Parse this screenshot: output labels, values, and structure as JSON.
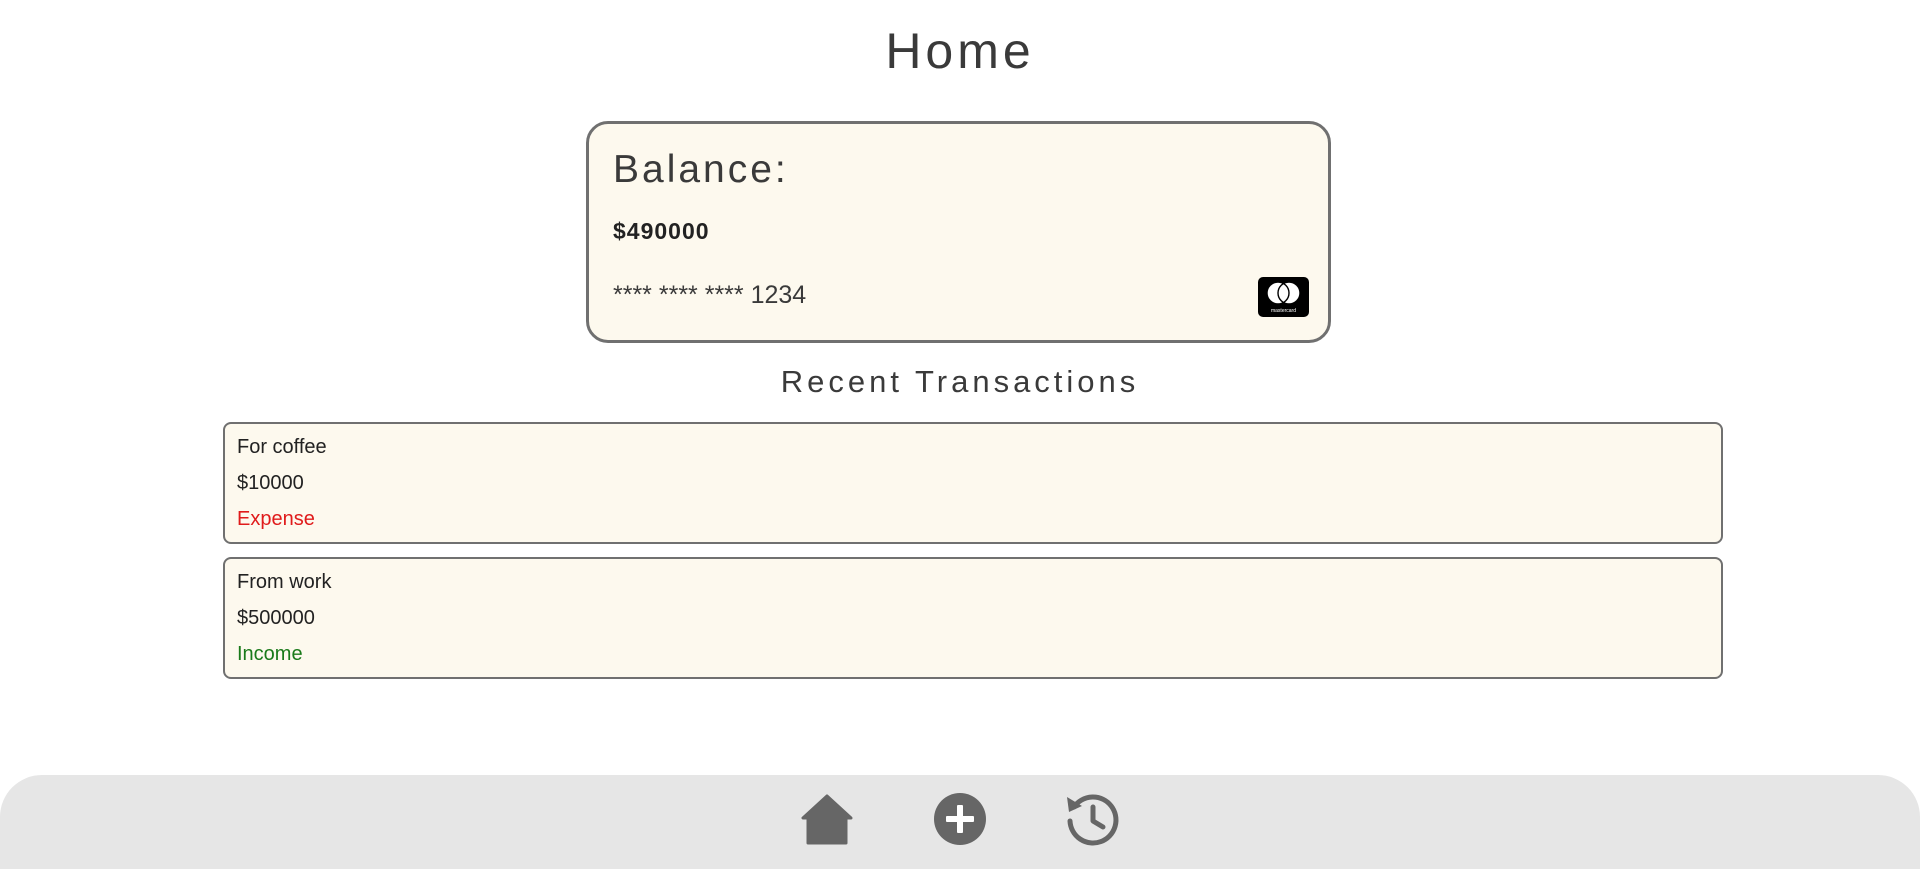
{
  "header": {
    "title": "Home"
  },
  "balance_card": {
    "label": "Balance:",
    "amount": "$490000",
    "card_number": "**** **** **** 1234",
    "card_brand_icon": "mastercard-logo-icon",
    "card_brand_text": "mastercard"
  },
  "transactions": {
    "title": "Recent Transactions",
    "items": [
      {
        "description": "For coffee",
        "amount": "$10000",
        "type": "Expense",
        "type_color": "#e01b1b"
      },
      {
        "description": "From work",
        "amount": "$500000",
        "type": "Income",
        "type_color": "#1a7a1a"
      }
    ]
  },
  "bottom_nav": {
    "items": [
      {
        "icon": "home-icon"
      },
      {
        "icon": "add-circle-icon"
      },
      {
        "icon": "history-icon"
      }
    ]
  },
  "colors": {
    "card_background": "#fdf9ee",
    "border": "#707070",
    "nav_background": "#e6e6e6",
    "icon": "#666666"
  }
}
